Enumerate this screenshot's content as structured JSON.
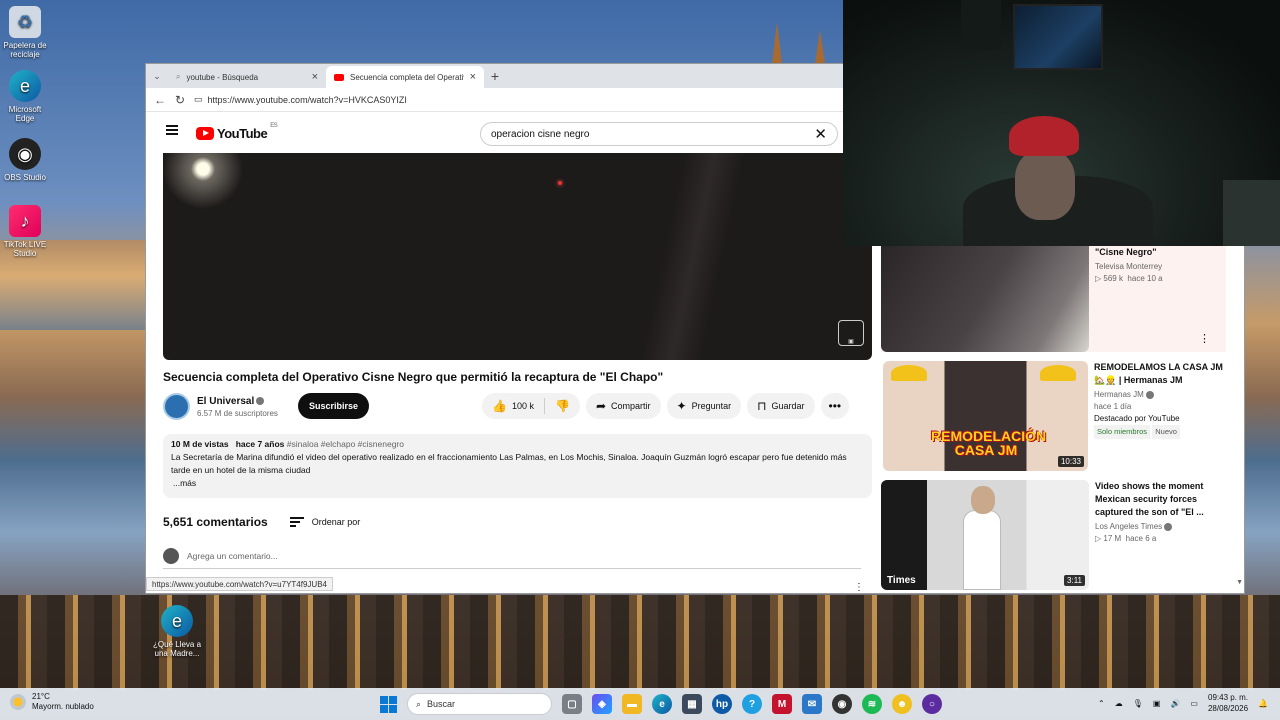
{
  "desktop": {
    "icons": [
      {
        "label": "Papelera de reciclaje",
        "icon": "recycle-bin-icon"
      },
      {
        "label": "Microsoft Edge",
        "icon": "edge-icon"
      },
      {
        "label": "OBS Studio",
        "icon": "obs-icon"
      },
      {
        "label": "TikTok LIVE Studio",
        "icon": "tiktok-icon"
      },
      {
        "label": "¿Qué Lleva a una Madre...",
        "icon": "edge-shortcut-icon"
      }
    ]
  },
  "browser": {
    "tabs": [
      {
        "label": "youtube - Búsqueda",
        "icon": "search-icon",
        "active": false
      },
      {
        "label": "Secuencia completa del Operativo",
        "icon": "youtube-icon",
        "active": true
      }
    ],
    "new_tab": "+",
    "url": "https://www.youtube.com/watch?v=HVKCAS0YIZI",
    "status_url": "https://www.youtube.com/watch?v=u7YT4f9JUB4"
  },
  "youtube": {
    "logo": "YouTube",
    "country": "ES",
    "search_query": "operacion cisne negro",
    "video": {
      "title": "Secuencia completa del Operativo Cisne Negro que permitió la recaptura de \"El Chapo\"",
      "channel": "El Universal",
      "subscribers": "6.57 M de suscriptores",
      "subscribe_label": "Suscribirse",
      "likes": "100 k",
      "share_label": "Compartir",
      "ask_label": "Preguntar",
      "save_label": "Guardar",
      "views": "10 M de vistas",
      "age": "hace 7 años",
      "tags": "#sinaloa #elchapo #cisnenegro",
      "description": "La Secretaría de Marina difundió el video del operativo realizado en el fraccionamiento Las Palmas, en Los Mochis, Sinaloa. Joaquín Guzmán logró escapar pero fue detenido más tarde en un hotel de la misma ciudad",
      "more": "...más"
    },
    "comments": {
      "count": "5,651 comentarios",
      "sort_label": "Ordenar por",
      "placeholder": "Agrega un comentario..."
    },
    "recommendations": [
      {
        "title": "\"Cisne Negro\"",
        "channel": "Televisa Monterrey",
        "views": "569 k",
        "age": "hace 10 a",
        "duration": ""
      },
      {
        "title": "REMODELAMOS LA CASA JM 🏡👷 | Hermanas JM",
        "channel": "Hermanas JM",
        "age": "hace 1 día",
        "featured": "Destacado por YouTube",
        "badge_members": "Solo miembros",
        "badge_new": "Nuevo",
        "duration": "10:33",
        "thumb_text": "REMODELACIÓN CASA JM"
      },
      {
        "title": "Video shows the moment Mexican security forces captured the son of \"El ...",
        "channel": "Los Angeles Times",
        "views": "17 M",
        "age": "hace 6 a",
        "duration": "3:11",
        "thumb_text": "Times"
      }
    ]
  },
  "taskbar": {
    "temperature": "21°C",
    "weather": "Mayorm. nublado",
    "search_placeholder": "Buscar",
    "time": "09:43 p. m.",
    "date": "28/08/2026"
  }
}
